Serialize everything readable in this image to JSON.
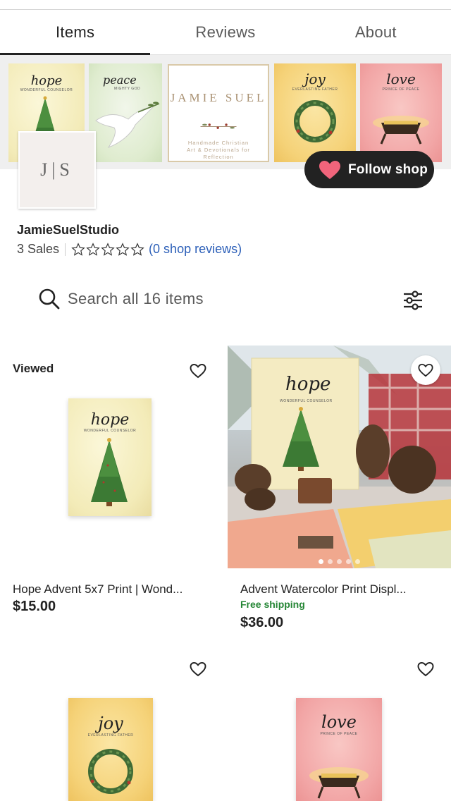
{
  "tabs": [
    {
      "label": "Items",
      "active": true
    },
    {
      "label": "Reviews",
      "active": false
    },
    {
      "label": "About",
      "active": false
    }
  ],
  "banner": {
    "cards": [
      {
        "word": "hope",
        "sub": "Wonderful Counselor"
      },
      {
        "word": "peace",
        "sub": "Mighty God"
      },
      {
        "brand": "JAMIE SUEL",
        "tagline": "Handmade Christian Art & Devotionals for Reflection"
      },
      {
        "word": "joy",
        "sub": "Everlasting Father"
      },
      {
        "word": "love",
        "sub": "Prince of Peace"
      }
    ]
  },
  "shop": {
    "logo_text": "J|S",
    "follow_label": "Follow shop",
    "name": "JamieSuelStudio",
    "sales": "3 Sales",
    "rating_stars": 0,
    "reviews_link": "(0 shop reviews)"
  },
  "search": {
    "placeholder": "Search all 16 items",
    "icon": "search-icon",
    "filter_icon": "sliders-icon"
  },
  "products": [
    {
      "badge": "Viewed",
      "title": "Hope Advent 5x7 Print | Wond...",
      "price": "$15.00",
      "word": "hope",
      "sub": "Wonderful Counselor"
    },
    {
      "title": "Advent Watercolor Print Displ...",
      "shipping": "Free shipping",
      "price": "$36.00",
      "photo_word": "hope",
      "photo_sub": "Wonderful Counselor"
    },
    {
      "word": "joy",
      "sub": "Everlasting Father"
    },
    {
      "word": "love",
      "sub": "Prince of Peace"
    }
  ],
  "colors": {
    "accent_heart": "#f1647b",
    "link": "#2c5fb8",
    "free_shipping": "#258635",
    "dark": "#222222"
  }
}
